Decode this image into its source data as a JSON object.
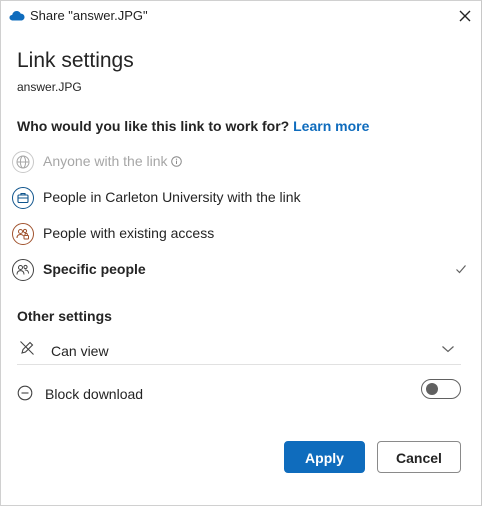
{
  "window": {
    "title": "Share \"answer.JPG\""
  },
  "panel": {
    "heading": "Link settings",
    "filename": "answer.JPG",
    "question": "Who would you like this link to work for?",
    "learn_more": "Learn more"
  },
  "options": [
    {
      "label": "Anyone with the link",
      "icon": "globe-icon",
      "state": "disabled"
    },
    {
      "label": "People in Carleton University with the link",
      "icon": "briefcase-icon",
      "state": "enabled"
    },
    {
      "label": "People with existing access",
      "icon": "people-lock-icon",
      "state": "enabled"
    },
    {
      "label": "Specific people",
      "icon": "people-icon",
      "state": "selected"
    }
  ],
  "other_settings": {
    "title": "Other settings",
    "permission": {
      "label": "Can view",
      "icon": "pencil-off-icon"
    },
    "block_download": {
      "label": "Block download",
      "icon": "minus-circle-icon",
      "enabled": false
    }
  },
  "buttons": {
    "apply": "Apply",
    "cancel": "Cancel"
  },
  "colors": {
    "accent": "#0f6cbd",
    "globe": "#a6a6a6",
    "org": "#0f548c",
    "existing": "#a0522d",
    "specific": "#424242"
  }
}
